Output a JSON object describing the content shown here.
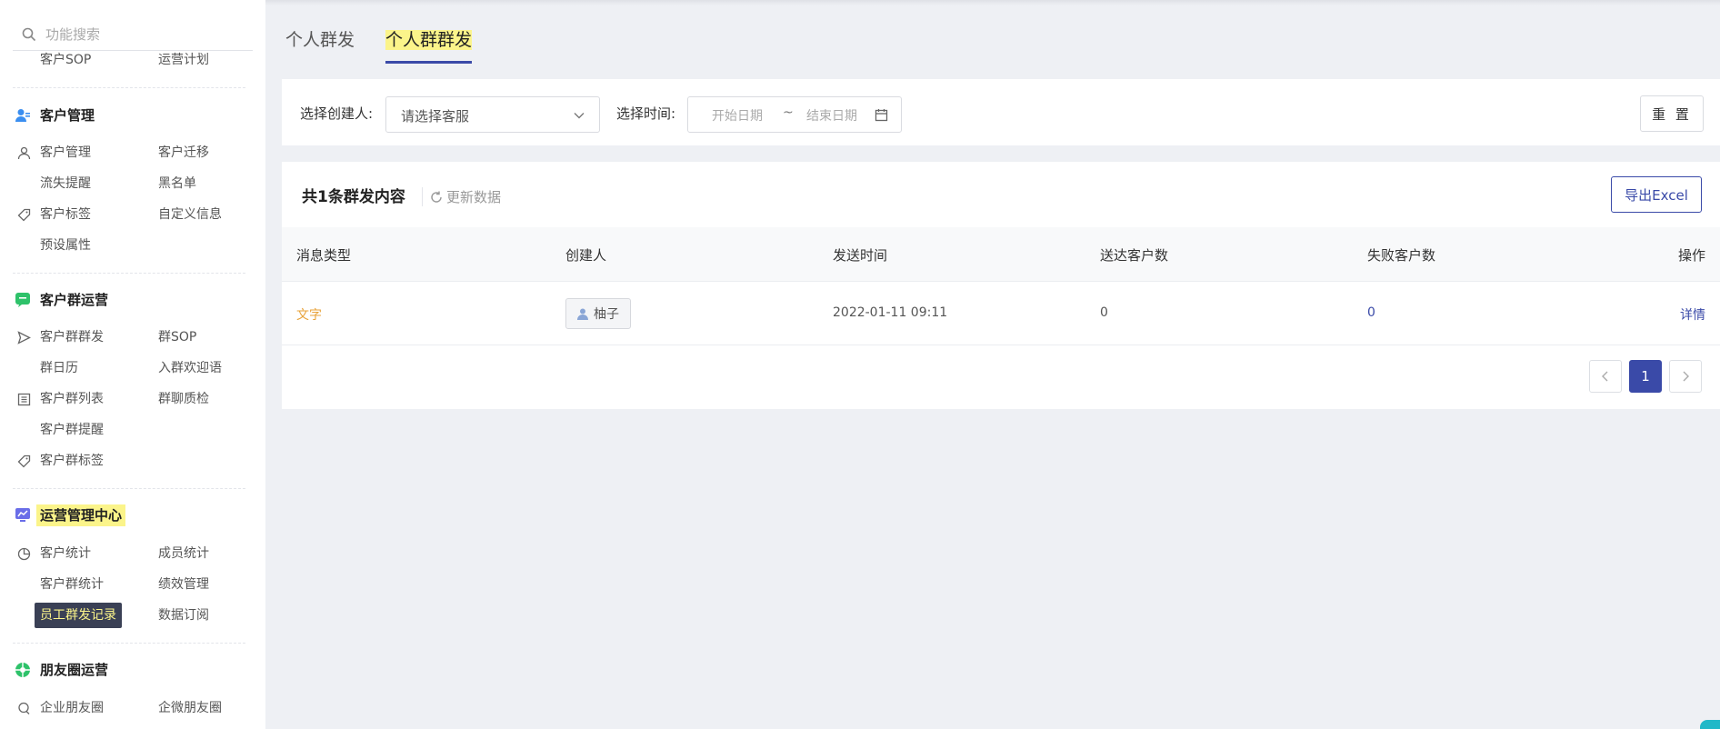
{
  "sidebar": {
    "search_placeholder": "功能搜索",
    "top_items": [
      "客户SOP",
      "运营计划"
    ],
    "sections": [
      {
        "title": "客户管理",
        "icon": "customer-icon",
        "items": [
          "客户管理",
          "客户迁移",
          "流失提醒",
          "黑名单",
          "客户标签",
          "自定义信息",
          "预设属性"
        ]
      },
      {
        "title": "客户群运营",
        "icon": "chat-icon",
        "items": [
          "客户群群发",
          "群SOP",
          "群日历",
          "入群欢迎语",
          "客户群列表",
          "群聊质检",
          "客户群提醒",
          "客户群标签"
        ]
      },
      {
        "title": "运营管理中心",
        "icon": "monitor-chart-icon",
        "items": [
          "客户统计",
          "成员统计",
          "客户群统计",
          "绩效管理",
          "员工群发记录",
          "数据订阅"
        ]
      },
      {
        "title": "朋友圈运营",
        "icon": "moments-icon",
        "items": [
          "企业朋友圈",
          "企微朋友圈"
        ]
      }
    ]
  },
  "tabs": [
    "个人群发",
    "个人群群发"
  ],
  "filters": {
    "creator_label": "选择创建人:",
    "creator_placeholder": "请选择客服",
    "time_label": "选择时间:",
    "start_placeholder": "开始日期",
    "separator": "~",
    "end_placeholder": "结束日期",
    "reset": "重 置"
  },
  "list": {
    "title": "共1条群发内容",
    "refresh": "更新数据",
    "export": "导出Excel",
    "columns": [
      "消息类型",
      "创建人",
      "发送时间",
      "送达客户数",
      "失败客户数",
      "操作"
    ],
    "rows": [
      {
        "type": "文字",
        "creator": "柚子",
        "time": "2022-01-11 09:11",
        "delivered": "0",
        "failed": "0",
        "action": "详情"
      }
    ]
  },
  "pagination": {
    "current": "1"
  },
  "colors": {
    "accent": "#3a4aa8",
    "highlight": "#fbf48a",
    "orange": "#e8a33a"
  }
}
